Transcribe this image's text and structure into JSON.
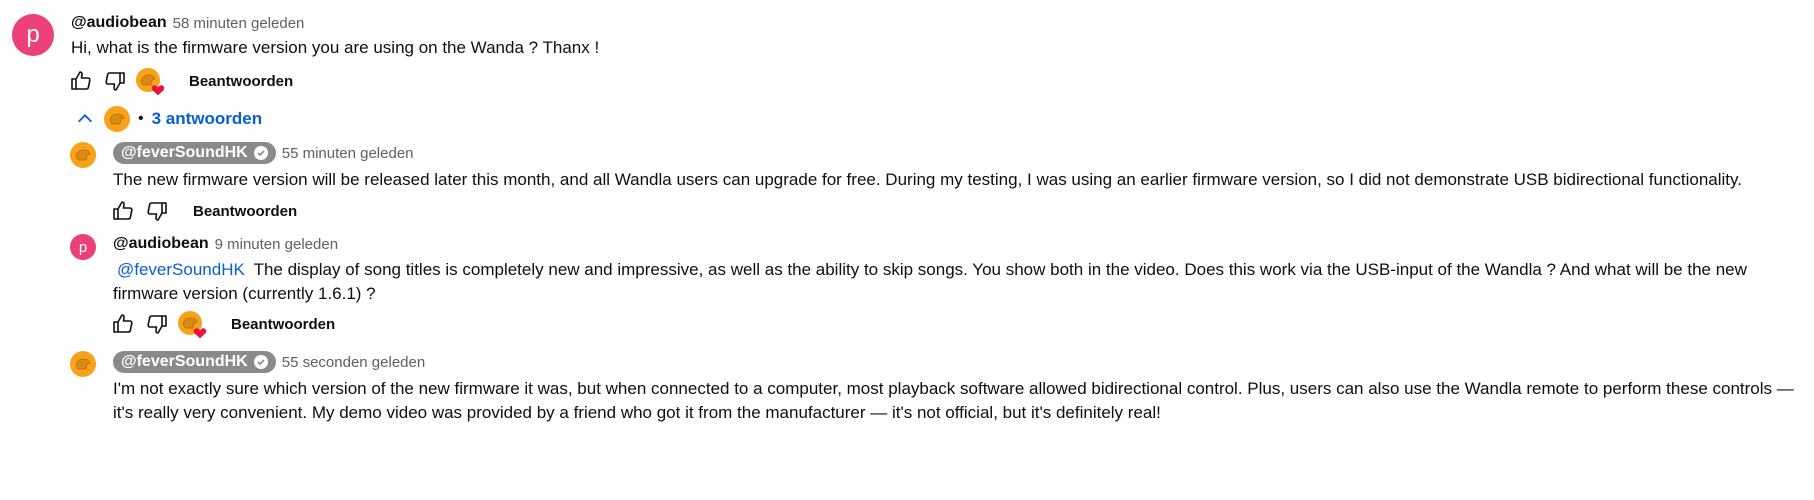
{
  "top_comment": {
    "avatar_letter": "p",
    "handle": "@audiobean",
    "time": "58 minuten geleden",
    "text": "Hi, what is the firmware version you are using on the Wanda ? Thanx !",
    "reply_label": "Beantwoorden",
    "liked_by_creator": true
  },
  "replies_toggle": {
    "label": "3 antwoorden",
    "separator": "•",
    "expanded": true
  },
  "replies": [
    {
      "avatar_type": "dog",
      "handle": "@feverSoundHK",
      "verified_creator": true,
      "time": "55 minuten geleden",
      "text": "The new firmware version will be released later this month, and all Wandla users can upgrade for free. During my testing, I was using an earlier firmware version, so I did not demonstrate USB bidirectional functionality.",
      "reply_label": "Beantwoorden",
      "liked_by_creator": false
    },
    {
      "avatar_type": "letter",
      "avatar_letter": "p",
      "handle": "@audiobean",
      "time": "9 minuten geleden",
      "mention": "@feverSoundHK",
      "text": "The display of song titles is completely new and impressive, as well as the ability to skip songs. You show both in the video. Does this work via the USB-input of the Wandla ? And what will be the new firmware version (currently 1.6.1) ?",
      "reply_label": "Beantwoorden",
      "liked_by_creator": true
    },
    {
      "avatar_type": "dog",
      "handle": "@feverSoundHK",
      "verified_creator": true,
      "time": "55 seconden geleden",
      "text": "I'm not exactly sure which version of the new firmware it was, but when connected to a computer, most playback software allowed bidirectional control. Plus, users can also use the Wandla remote to perform these controls — it's really very convenient. My demo video was provided by a friend who got it from the manufacturer — it's not official, but it's definitely real!"
    }
  ],
  "colors": {
    "link": "#065fd4",
    "avatar_p": "#ec407a",
    "avatar_dog": "#f7a21b",
    "chip": "#8a8a8a",
    "heart": "#e8123c"
  },
  "icons": [
    "thumb-up-icon",
    "thumb-down-icon",
    "heart-icon",
    "chevron-up-icon",
    "verified-check-icon"
  ]
}
